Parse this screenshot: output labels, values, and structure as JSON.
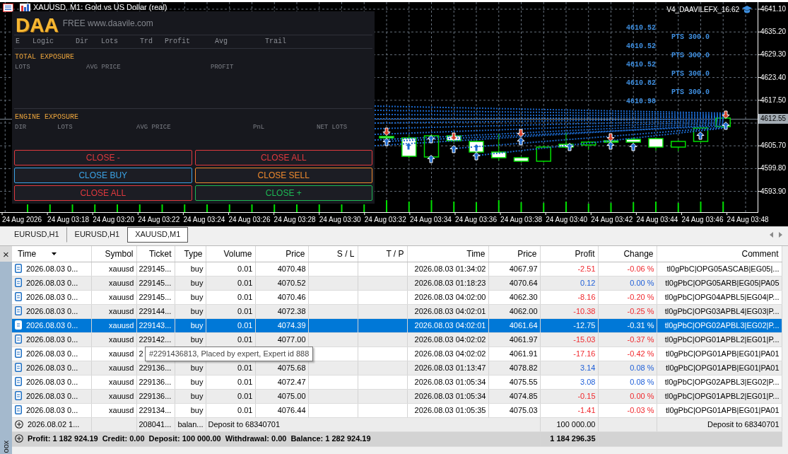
{
  "chart": {
    "title": "XAUUSD, M1: Gold vs US Dollar (real)",
    "expert": "V4_DAAVILEFX_16.62",
    "order_prices": [
      "4610.52",
      "4610.52",
      "4610.52",
      "4610.82",
      "4610.98"
    ],
    "target_labels": [
      "PTS 300.0",
      "PTS 300.0",
      "PTS 300.0",
      "PTS 300.0"
    ],
    "price_axis": [
      "4641.10",
      "4635.20",
      "4629.30",
      "4623.40",
      "4617.50",
      "4605.70",
      "4599.80",
      "4593.90"
    ],
    "current_price": "4612.55",
    "time_axis": [
      "24 Aug 2026",
      "24 Aug 03:18",
      "24 Aug 03:20",
      "24 Aug 03:22",
      "24 Aug 03:24",
      "24 Aug 03:26",
      "24 Aug 03:28",
      "24 Aug 03:30",
      "24 Aug 03:32",
      "24 Aug 03:34",
      "24 Aug 03:36",
      "24 Aug 03:38",
      "24 Aug 03:40",
      "24 Aug 03:42",
      "24 Aug 03:44",
      "24 Aug 03:46",
      "24 Aug 03:48"
    ]
  },
  "panel": {
    "brand": "DAA",
    "tagline": "FREE www.daavile.com",
    "columns": [
      "E",
      "Logic",
      "Dir",
      "Lots",
      "Trd",
      "Profit",
      "Avg",
      "Trail"
    ],
    "sections": [
      {
        "title": "TOTAL EXPOSURE",
        "fields": [
          "LOTS",
          "AVG PRICE",
          "PROFIT"
        ]
      },
      {
        "title": "ENGINE EXPOSURE",
        "fields": [
          "DIR",
          "LOTS",
          "AVG PRICE",
          "PnL",
          "NET LOTS"
        ]
      }
    ],
    "buttons": [
      {
        "label": "CLOSE -",
        "color": "#e0393e"
      },
      {
        "label": "CLOSE ALL",
        "color": "#e0393e"
      },
      {
        "label": "CLOSE BUY",
        "color": "#3ba3e6"
      },
      {
        "label": "CLOSE SELL",
        "color": "#ef8a2e"
      },
      {
        "label": "CLOSE ALL",
        "color": "#e0393e"
      },
      {
        "label": "CLOSE +",
        "color": "#1db954"
      }
    ]
  },
  "chart_tabs": [
    {
      "label": "EURUSD,H1",
      "selected": false
    },
    {
      "label": "EURUSD,H1",
      "selected": false
    },
    {
      "label": "XAUUSD,M1",
      "selected": true
    }
  ],
  "toolbox": {
    "close": "×",
    "sidebar_title": "oox",
    "columns": [
      {
        "label": "Time",
        "sorted": true
      },
      {
        "label": "Symbol",
        "sorted": false
      },
      {
        "label": "Ticket",
        "sorted": false
      },
      {
        "label": "Type",
        "sorted": false
      },
      {
        "label": "Volume",
        "sorted": false
      },
      {
        "label": "Price",
        "sorted": false
      },
      {
        "label": "S / L",
        "sorted": false
      },
      {
        "label": "T / P",
        "sorted": false
      },
      {
        "label": "Time",
        "sorted": false
      },
      {
        "label": "Price",
        "sorted": false
      },
      {
        "label": "Profit",
        "sorted": false
      },
      {
        "label": "Change",
        "sorted": false
      },
      {
        "label": "Comment",
        "sorted": false
      }
    ],
    "rows": [
      {
        "kind": "order",
        "selected": false,
        "time": "2026.08.03 0...",
        "symbol": "xauusd",
        "ticket": "229145...",
        "type": "buy",
        "volume": "0.01",
        "price": "4070.48",
        "close_time": "2026.08.03 01:34:02",
        "close_price": "4067.97",
        "profit": "-2.51",
        "change": "-0.06 %",
        "comment": "tl0gPbC|OPG05ASCAB|EG05|...",
        "color": "#f0282d"
      },
      {
        "kind": "order",
        "selected": false,
        "time": "2026.08.03 0...",
        "symbol": "xauusd",
        "ticket": "229145...",
        "type": "buy",
        "volume": "0.01",
        "price": "4070.52",
        "close_time": "2026.08.03 01:18:23",
        "close_price": "4070.64",
        "profit": "0.12",
        "change": "0.00 %",
        "comment": "tl0gPbC|OPG05ARB|EG05|PA05",
        "color": "#1f5fd8"
      },
      {
        "kind": "order",
        "selected": false,
        "time": "2026.08.03 0...",
        "symbol": "xauusd",
        "ticket": "229145...",
        "type": "buy",
        "volume": "0.01",
        "price": "4070.46",
        "close_time": "2026.08.03 04:02:00",
        "close_price": "4062.30",
        "profit": "-8.16",
        "change": "-0.20 %",
        "comment": "tl0gPbC|OPG04APBL5|EG04|P...",
        "color": "#f0282d"
      },
      {
        "kind": "order",
        "selected": false,
        "time": "2026.08.03 0...",
        "symbol": "xauusd",
        "ticket": "229144...",
        "type": "buy",
        "volume": "0.01",
        "price": "4072.38",
        "close_time": "2026.08.03 04:02:01",
        "close_price": "4062.00",
        "profit": "-10.38",
        "change": "-0.25 %",
        "comment": "tl0gPbC|OPG03APBL4|EG03|P...",
        "color": "#f0282d"
      },
      {
        "kind": "order",
        "selected": true,
        "time": "2026.08.03 0...",
        "symbol": "xauusd",
        "ticket": "229143...",
        "type": "buy",
        "volume": "0.01",
        "price": "4074.39",
        "close_time": "2026.08.03 04:02:01",
        "close_price": "4061.64",
        "profit": "-12.75",
        "change": "-0.31 %",
        "comment": "tl0gPbC|OPG02APBL3|EG02|P..."
      },
      {
        "kind": "order",
        "selected": false,
        "time": "2026.08.03 0...",
        "symbol": "xauusd",
        "ticket": "229142...",
        "type": "buy",
        "volume": "0.01",
        "price": "4077.00",
        "close_time": "2026.08.03 04:02:02",
        "close_price": "4061.97",
        "profit": "-15.03",
        "change": "-0.37 %",
        "comment": "tl0gPbC|OPG01APBL2|EG01|P...",
        "color": "#f0282d"
      },
      {
        "kind": "order",
        "selected": false,
        "time": "2026.08.03 0...",
        "symbol": "xauusd",
        "ticket": "2",
        "close_time": "2026.08.03 04:02:02",
        "close_price": "4061.91",
        "profit": "-17.16",
        "change": "-0.42 %",
        "comment": "tl0gPbC|OPG01APB|EG01|PA01",
        "color": "#f0282d"
      },
      {
        "kind": "order",
        "selected": false,
        "time": "2026.08.03 0...",
        "symbol": "xauusd",
        "ticket": "229136...",
        "type": "buy",
        "volume": "0.01",
        "price": "4075.68",
        "close_time": "2026.08.03 01:13:47",
        "close_price": "4078.82",
        "profit": "3.14",
        "change": "0.08 %",
        "comment": "tl0gPbC|OPG01APB|EG01|PA01",
        "color": "#1f5fd8"
      },
      {
        "kind": "order",
        "selected": false,
        "time": "2026.08.03 0...",
        "symbol": "xauusd",
        "ticket": "229136...",
        "type": "buy",
        "volume": "0.01",
        "price": "4072.47",
        "close_time": "2026.08.03 01:05:34",
        "close_price": "4075.55",
        "profit": "3.08",
        "change": "0.08 %",
        "comment": "tl0gPbC|OPG02APBL3|EG02|P...",
        "color": "#1f5fd8"
      },
      {
        "kind": "order",
        "selected": false,
        "time": "2026.08.03 0...",
        "symbol": "xauusd",
        "ticket": "229136...",
        "type": "buy",
        "volume": "0.01",
        "price": "4075.00",
        "close_time": "2026.08.03 01:05:34",
        "close_price": "4074.85",
        "profit": "-0.15",
        "change": "0.00 %",
        "comment": "tl0gPbC|OPG01APBL2|EG01|P...",
        "color": "#f0282d"
      },
      {
        "kind": "order",
        "selected": false,
        "time": "2026.08.03 0...",
        "symbol": "xauusd",
        "ticket": "229134...",
        "type": "buy",
        "volume": "0.01",
        "price": "4076.44",
        "close_time": "2026.08.03 01:05:35",
        "close_price": "4075.03",
        "profit": "-1.41",
        "change": "-0.03 %",
        "comment": "tl0gPbC|OPG01APB|EG01|PA01",
        "color": "#f0282d"
      },
      {
        "kind": "balance",
        "selected": false,
        "time": "2026.08.02 1...",
        "ticket": "208041...",
        "type": "balan...",
        "description": "Deposit to 68340701",
        "profit": "100 000.00",
        "comment": "Deposit to 68340701"
      }
    ],
    "summary": {
      "items": [
        "Profit: 1 182 924.19",
        "Credit: 0.00",
        "Deposit: 100 000.00",
        "Withdrawal: 0.00",
        "Balance: 1 282 924.19"
      ],
      "total": "1 184 296.35"
    },
    "tooltip": "#2291436813, Placed by expert, Expert id 888"
  }
}
